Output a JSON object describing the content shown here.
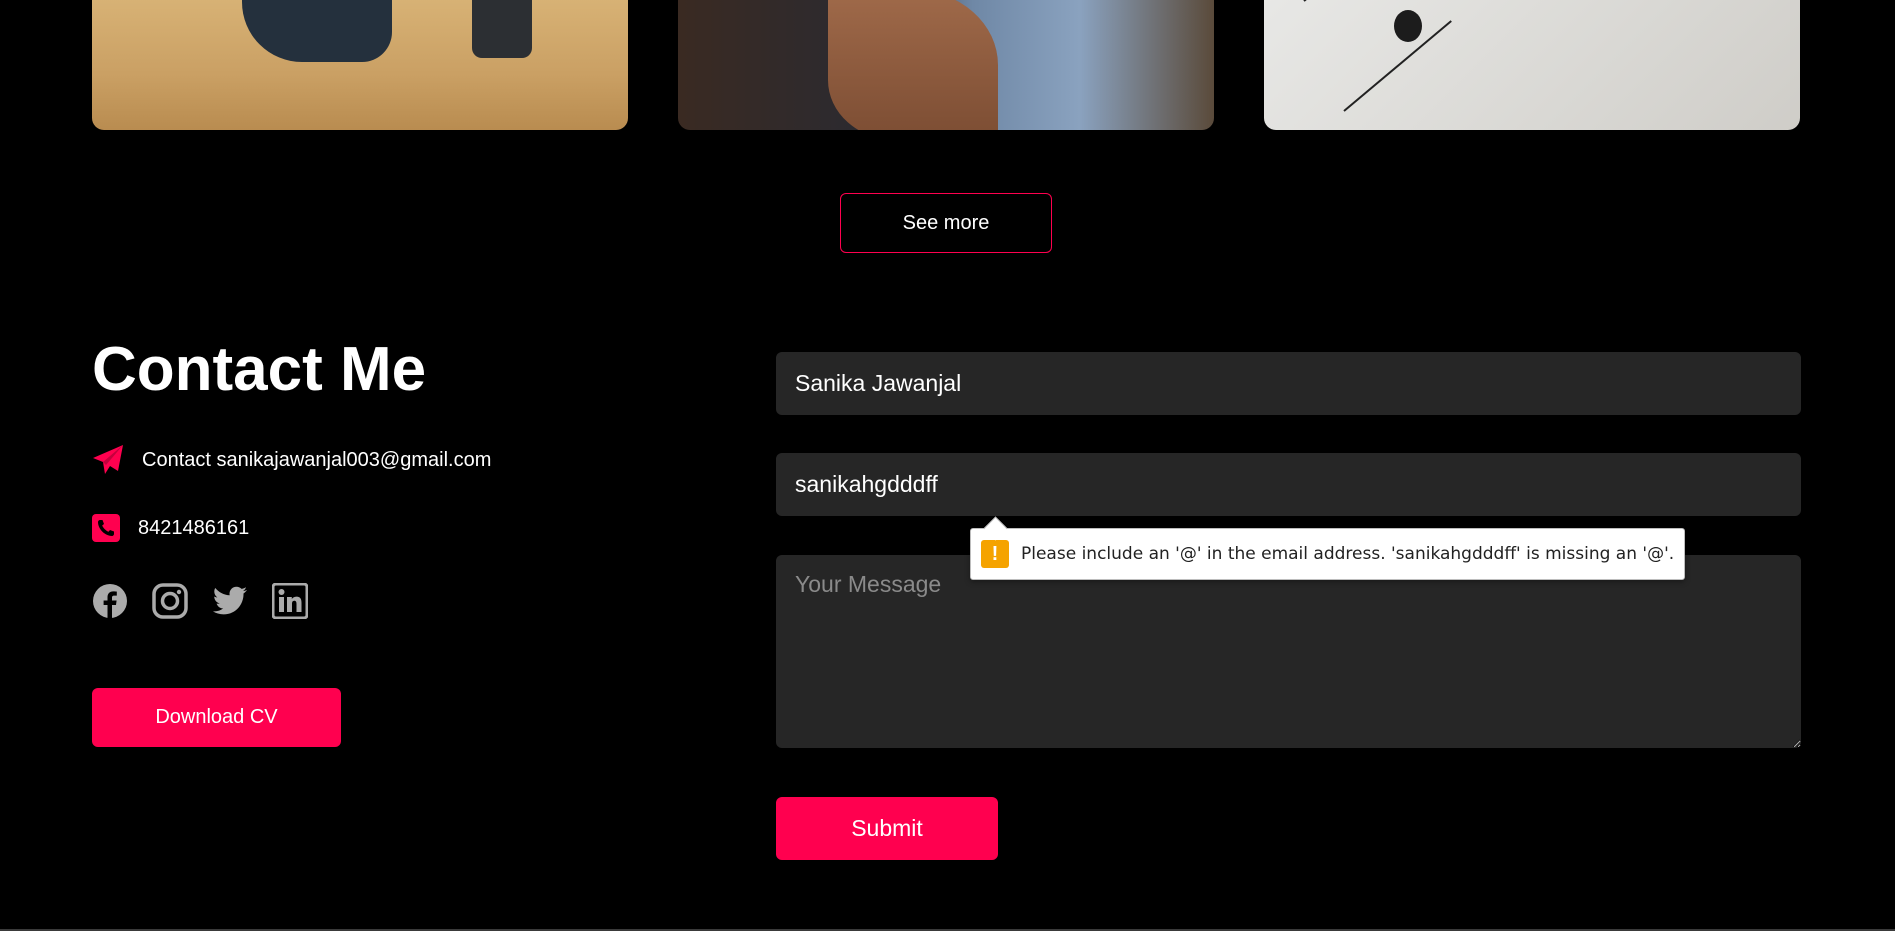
{
  "portfolio": {
    "see_more_label": "See more"
  },
  "contact": {
    "title": "Contact Me",
    "email_text": "Contact sanikajawanjal003@gmail.com",
    "phone_text": "8421486161",
    "socials": [
      "facebook-icon",
      "instagram-icon",
      "twitter-icon",
      "linkedin-icon"
    ],
    "download_cv_label": "Download CV"
  },
  "form": {
    "name_value": "Sanika Jawanjal",
    "email_value": "sanikahgdddff",
    "message_placeholder": "Your Message",
    "submit_label": "Submit",
    "validation_message": "Please include an '@' in the email address. 'sanikahgdddff' is missing an '@'.",
    "warning_symbol": "!"
  },
  "colors": {
    "accent": "#ff004f",
    "background": "#000000",
    "field_bg": "#262626",
    "warning": "#f5a300"
  }
}
